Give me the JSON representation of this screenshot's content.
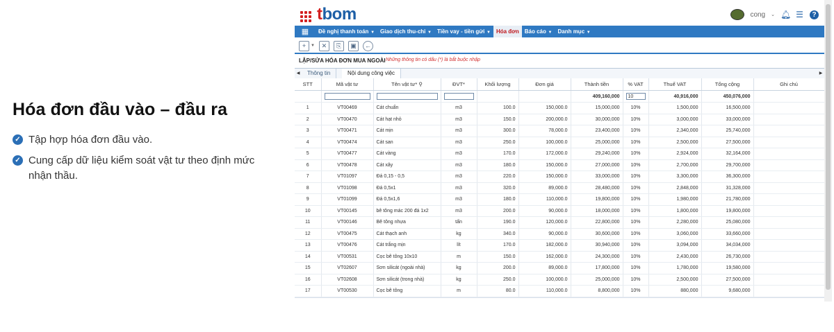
{
  "left": {
    "title": "Hóa đơn đầu vào – đầu ra",
    "bullets": [
      "Tập hợp hóa đơn đầu vào.",
      "Cung cấp dữ liệu kiểm soát vật tư theo định mức nhận thầu."
    ]
  },
  "brand": {
    "t": "t",
    "rest": "bom"
  },
  "user": {
    "name": "cong"
  },
  "menu": [
    {
      "label": "Đề nghị thanh toán"
    },
    {
      "label": "Giao dịch thu-chi"
    },
    {
      "label": "Tiền vay - tiền gửi"
    },
    {
      "label": "Hóa đơn",
      "active": true
    },
    {
      "label": "Báo cáo"
    },
    {
      "label": "Danh mục"
    }
  ],
  "form": {
    "title": "LẬP/SỬA HÓA ĐƠN MUA NGOÀI",
    "note": "Những thông tin có dấu (*) là bắt buộc nhập"
  },
  "tabs": [
    "Thông tin",
    "Nội dung công việc"
  ],
  "table": {
    "columns": [
      "STT",
      "Mã vật tư",
      "Tên vật tư* ⚲",
      "ĐVT*",
      "Khối lượng",
      "Đơn giá",
      "Thành tiền",
      "% VAT",
      "Thuế VAT",
      "Tổng cộng",
      "Ghi chú"
    ],
    "totals": {
      "thanh_tien": "409,160,000",
      "vat": "10",
      "thue_vat": "40,916,000",
      "tong_cong": "450,076,000"
    },
    "rows": [
      [
        "1",
        "VT00469",
        "Cát chuẩn",
        "m3",
        "100.0",
        "150,000.0",
        "15,000,000",
        "10%",
        "1,500,000",
        "16,500,000",
        ""
      ],
      [
        "2",
        "VT00470",
        "Cát hạt nhỏ",
        "m3",
        "150.0",
        "200,000.0",
        "30,000,000",
        "10%",
        "3,000,000",
        "33,000,000",
        ""
      ],
      [
        "3",
        "VT00471",
        "Cát mịn",
        "m3",
        "300.0",
        "78,000.0",
        "23,400,000",
        "10%",
        "2,340,000",
        "25,740,000",
        ""
      ],
      [
        "4",
        "VT00474",
        "Cát san",
        "m3",
        "250.0",
        "100,000.0",
        "25,000,000",
        "10%",
        "2,500,000",
        "27,500,000",
        ""
      ],
      [
        "5",
        "VT00477",
        "Cát vàng",
        "m3",
        "170.0",
        "172,000.0",
        "29,240,000",
        "10%",
        "2,924,000",
        "32,164,000",
        ""
      ],
      [
        "6",
        "VT00478",
        "Cát xây",
        "m3",
        "180.0",
        "150,000.0",
        "27,000,000",
        "10%",
        "2,700,000",
        "29,700,000",
        ""
      ],
      [
        "7",
        "VT01097",
        "Đá 0,15 - 0,5",
        "m3",
        "220.0",
        "150,000.0",
        "33,000,000",
        "10%",
        "3,300,000",
        "36,300,000",
        ""
      ],
      [
        "8",
        "VT01098",
        "Đá 0,5x1",
        "m3",
        "320.0",
        "89,000.0",
        "28,480,000",
        "10%",
        "2,848,000",
        "31,328,000",
        ""
      ],
      [
        "9",
        "VT01099",
        "Đá 0,5x1,6",
        "m3",
        "180.0",
        "110,000.0",
        "19,800,000",
        "10%",
        "1,980,000",
        "21,780,000",
        ""
      ],
      [
        "10",
        "VT00145",
        "bê tông mác 200 đá 1x2",
        "m3",
        "200.0",
        "90,000.0",
        "18,000,000",
        "10%",
        "1,800,000",
        "19,800,000",
        ""
      ],
      [
        "11",
        "VT00146",
        "Bê tông nhựa",
        "tấn",
        "190.0",
        "120,000.0",
        "22,800,000",
        "10%",
        "2,280,000",
        "25,080,000",
        ""
      ],
      [
        "12",
        "VT00475",
        "Cát thạch anh",
        "kg",
        "340.0",
        "90,000.0",
        "30,600,000",
        "10%",
        "3,060,000",
        "33,660,000",
        ""
      ],
      [
        "13",
        "VT00476",
        "Cát trắng mịn",
        "lít",
        "170.0",
        "182,000.0",
        "30,940,000",
        "10%",
        "3,094,000",
        "34,034,000",
        ""
      ],
      [
        "14",
        "VT00531",
        "Cọc bê tông 10x10",
        "m",
        "150.0",
        "162,000.0",
        "24,300,000",
        "10%",
        "2,430,000",
        "26,730,000",
        ""
      ],
      [
        "15",
        "VT02607",
        "Sơn silicát (ngoài nhà)",
        "kg",
        "200.0",
        "89,000.0",
        "17,800,000",
        "10%",
        "1,780,000",
        "19,580,000",
        ""
      ],
      [
        "16",
        "VT02608",
        "Sơn silicát (trong nhà)",
        "kg",
        "250.0",
        "100,000.0",
        "25,000,000",
        "10%",
        "2,500,000",
        "27,500,000",
        ""
      ],
      [
        "17",
        "VT00530",
        "Cọc bê tông",
        "m",
        "80.0",
        "110,000.0",
        "8,800,000",
        "10%",
        "880,000",
        "9,680,000",
        ""
      ]
    ]
  },
  "colors": {
    "menu_bg": "#2f79c2",
    "brand_blue": "#1d5fa6",
    "brand_red": "#d32020",
    "total_red": "#d12b2b"
  }
}
